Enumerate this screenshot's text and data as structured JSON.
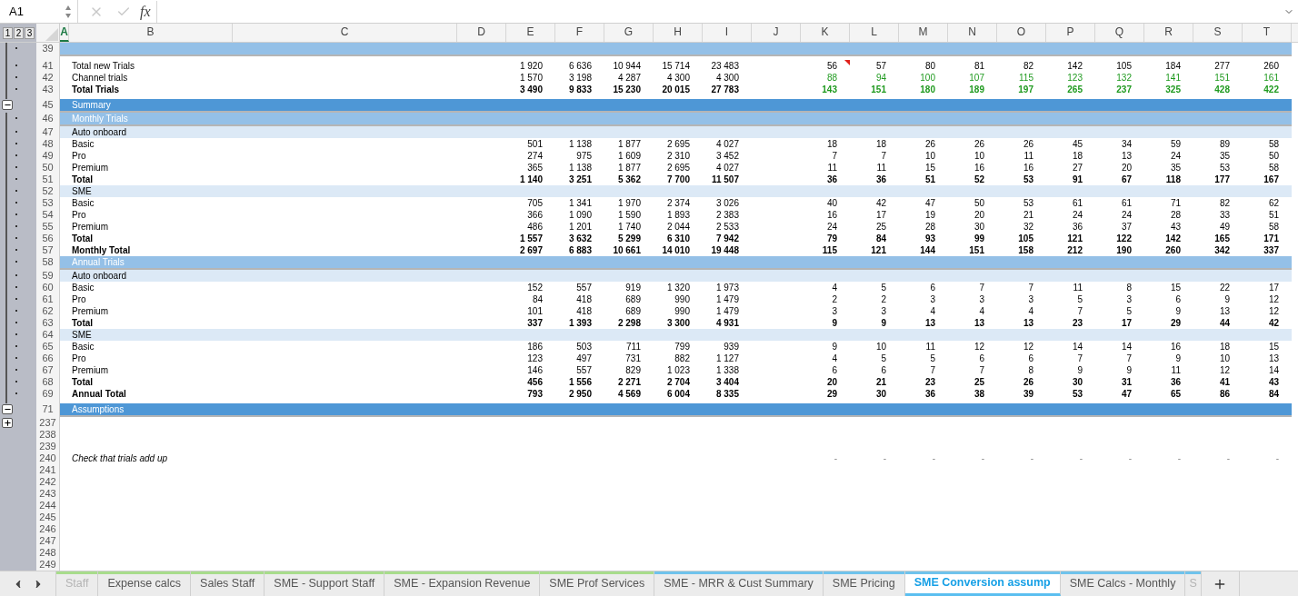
{
  "formula_bar": {
    "name_box": "A1",
    "formula_icon": "fx"
  },
  "outline_levels": [
    {
      "label": "1"
    },
    {
      "label": "2"
    },
    {
      "label": "3"
    }
  ],
  "columns": [
    {
      "label": "A",
      "selected": true
    },
    {
      "label": "B",
      "selected": false
    },
    {
      "label": "C",
      "selected": false
    },
    {
      "label": "D",
      "selected": false
    },
    {
      "label": "E",
      "selected": false
    },
    {
      "label": "F",
      "selected": false
    },
    {
      "label": "G",
      "selected": false
    },
    {
      "label": "H",
      "selected": false
    },
    {
      "label": "I",
      "selected": false
    },
    {
      "label": "J",
      "selected": false
    },
    {
      "label": "K",
      "selected": false
    },
    {
      "label": "L",
      "selected": false
    },
    {
      "label": "M",
      "selected": false
    },
    {
      "label": "N",
      "selected": false
    },
    {
      "label": "O",
      "selected": false
    },
    {
      "label": "P",
      "selected": false
    },
    {
      "label": "Q",
      "selected": false
    },
    {
      "label": "R",
      "selected": false
    },
    {
      "label": "S",
      "selected": false
    },
    {
      "label": "T",
      "selected": false
    }
  ],
  "rows": [
    {
      "num": "39",
      "kind": "subsection",
      "outline": {
        "kind": "dot"
      },
      "hidden_after": true
    },
    {
      "num": "41",
      "kind": "item",
      "label": "Total new Trials",
      "ei": [
        "1 920",
        "6 636",
        "10 944",
        "15 714",
        "23 483"
      ],
      "kt": [
        "56",
        "57",
        "80",
        "81",
        "82",
        "142",
        "105",
        "184",
        "277",
        "260"
      ],
      "outline": {
        "kind": "dot"
      },
      "comment": true
    },
    {
      "num": "42",
      "kind": "item",
      "label": "Channel trials",
      "ei": [
        "1 570",
        "3 198",
        "4 287",
        "4 300",
        "4 300"
      ],
      "kt": [
        "88",
        "94",
        "100",
        "107",
        "115",
        "123",
        "132",
        "141",
        "151",
        "161"
      ],
      "outline": {
        "kind": "dot"
      },
      "green": true
    },
    {
      "num": "43",
      "kind": "total",
      "label": "Total Trials",
      "ei": [
        "3 490",
        "9 833",
        "15 230",
        "20 015",
        "27 783"
      ],
      "kt": [
        "143",
        "151",
        "180",
        "189",
        "197",
        "265",
        "237",
        "325",
        "428",
        "422"
      ],
      "outline": {
        "kind": "dot"
      },
      "green": true,
      "hidden_after": true
    },
    {
      "num": "45",
      "kind": "section",
      "label": "Summary",
      "outline": {
        "kind": "minus"
      }
    },
    {
      "num": "46",
      "kind": "subsection",
      "label": "Monthly Trials",
      "outline": {
        "kind": "dot"
      }
    },
    {
      "num": "47",
      "kind": "group",
      "label": "Auto onboard",
      "outline": {
        "kind": "dot"
      }
    },
    {
      "num": "48",
      "kind": "item",
      "label": "Basic",
      "ei": [
        "501",
        "1 138",
        "1 877",
        "2 695",
        "4 027"
      ],
      "kt": [
        "18",
        "18",
        "26",
        "26",
        "26",
        "45",
        "34",
        "59",
        "89",
        "58"
      ],
      "outline": {
        "kind": "dot"
      }
    },
    {
      "num": "49",
      "kind": "item",
      "label": "Pro",
      "ei": [
        "274",
        "975",
        "1 609",
        "2 310",
        "3 452"
      ],
      "kt": [
        "7",
        "7",
        "10",
        "10",
        "11",
        "18",
        "13",
        "24",
        "35",
        "50"
      ],
      "outline": {
        "kind": "dot"
      }
    },
    {
      "num": "50",
      "kind": "item",
      "label": "Premium",
      "ei": [
        "365",
        "1 138",
        "1 877",
        "2 695",
        "4 027"
      ],
      "kt": [
        "11",
        "11",
        "15",
        "16",
        "16",
        "27",
        "20",
        "35",
        "53",
        "58"
      ],
      "outline": {
        "kind": "dot"
      }
    },
    {
      "num": "51",
      "kind": "total",
      "label": "Total",
      "ei": [
        "1 140",
        "3 251",
        "5 362",
        "7 700",
        "11 507"
      ],
      "kt": [
        "36",
        "36",
        "51",
        "52",
        "53",
        "91",
        "67",
        "118",
        "177",
        "167"
      ],
      "outline": {
        "kind": "dot"
      }
    },
    {
      "num": "52",
      "kind": "group",
      "label": "SME",
      "outline": {
        "kind": "dot"
      }
    },
    {
      "num": "53",
      "kind": "item",
      "label": "Basic",
      "ei": [
        "705",
        "1 341",
        "1 970",
        "2 374",
        "3 026"
      ],
      "kt": [
        "40",
        "42",
        "47",
        "50",
        "53",
        "61",
        "61",
        "71",
        "82",
        "62"
      ],
      "outline": {
        "kind": "dot"
      }
    },
    {
      "num": "54",
      "kind": "item",
      "label": "Pro",
      "ei": [
        "366",
        "1 090",
        "1 590",
        "1 893",
        "2 383"
      ],
      "kt": [
        "16",
        "17",
        "19",
        "20",
        "21",
        "24",
        "24",
        "28",
        "33",
        "51"
      ],
      "outline": {
        "kind": "dot"
      }
    },
    {
      "num": "55",
      "kind": "item",
      "label": "Premium",
      "ei": [
        "486",
        "1 201",
        "1 740",
        "2 044",
        "2 533"
      ],
      "kt": [
        "24",
        "25",
        "28",
        "30",
        "32",
        "36",
        "37",
        "43",
        "49",
        "58"
      ],
      "outline": {
        "kind": "dot"
      }
    },
    {
      "num": "56",
      "kind": "total",
      "label": "Total",
      "ei": [
        "1 557",
        "3 632",
        "5 299",
        "6 310",
        "7 942"
      ],
      "kt": [
        "79",
        "84",
        "93",
        "99",
        "105",
        "121",
        "122",
        "142",
        "165",
        "171"
      ],
      "outline": {
        "kind": "dot"
      }
    },
    {
      "num": "57",
      "kind": "total",
      "label": "Monthly Total",
      "ei": [
        "2 697",
        "6 883",
        "10 661",
        "14 010",
        "19 448"
      ],
      "kt": [
        "115",
        "121",
        "144",
        "151",
        "158",
        "212",
        "190",
        "260",
        "342",
        "337"
      ],
      "outline": {
        "kind": "dot"
      }
    },
    {
      "num": "58",
      "kind": "subsection",
      "label": "Annual Trials",
      "outline": {
        "kind": "dot"
      }
    },
    {
      "num": "59",
      "kind": "group",
      "label": "Auto onboard",
      "outline": {
        "kind": "dot"
      }
    },
    {
      "num": "60",
      "kind": "item",
      "label": "Basic",
      "ei": [
        "152",
        "557",
        "919",
        "1 320",
        "1 973"
      ],
      "kt": [
        "4",
        "5",
        "6",
        "7",
        "7",
        "11",
        "8",
        "15",
        "22",
        "17"
      ],
      "outline": {
        "kind": "dot"
      }
    },
    {
      "num": "61",
      "kind": "item",
      "label": "Pro",
      "ei": [
        "84",
        "418",
        "689",
        "990",
        "1 479"
      ],
      "kt": [
        "2",
        "2",
        "3",
        "3",
        "3",
        "5",
        "3",
        "6",
        "9",
        "12"
      ],
      "outline": {
        "kind": "dot"
      }
    },
    {
      "num": "62",
      "kind": "item",
      "label": "Premium",
      "ei": [
        "101",
        "418",
        "689",
        "990",
        "1 479"
      ],
      "kt": [
        "3",
        "3",
        "4",
        "4",
        "4",
        "7",
        "5",
        "9",
        "13",
        "12"
      ],
      "outline": {
        "kind": "dot"
      }
    },
    {
      "num": "63",
      "kind": "total",
      "label": "Total",
      "ei": [
        "337",
        "1 393",
        "2 298",
        "3 300",
        "4 931"
      ],
      "kt": [
        "9",
        "9",
        "13",
        "13",
        "13",
        "23",
        "17",
        "29",
        "44",
        "42"
      ],
      "outline": {
        "kind": "dot"
      }
    },
    {
      "num": "64",
      "kind": "group",
      "label": "SME",
      "outline": {
        "kind": "dot"
      }
    },
    {
      "num": "65",
      "kind": "item",
      "label": "Basic",
      "ei": [
        "186",
        "503",
        "711",
        "799",
        "939"
      ],
      "kt": [
        "9",
        "10",
        "11",
        "12",
        "12",
        "14",
        "14",
        "16",
        "18",
        "15"
      ],
      "outline": {
        "kind": "dot"
      }
    },
    {
      "num": "66",
      "kind": "item",
      "label": "Pro",
      "ei": [
        "123",
        "497",
        "731",
        "882",
        "1 127"
      ],
      "kt": [
        "4",
        "5",
        "5",
        "6",
        "6",
        "7",
        "7",
        "9",
        "10",
        "13"
      ],
      "outline": {
        "kind": "dot"
      }
    },
    {
      "num": "67",
      "kind": "item",
      "label": "Premium",
      "ei": [
        "146",
        "557",
        "829",
        "1 023",
        "1 338"
      ],
      "kt": [
        "6",
        "6",
        "7",
        "7",
        "8",
        "9",
        "9",
        "11",
        "12",
        "14"
      ],
      "outline": {
        "kind": "dot"
      }
    },
    {
      "num": "68",
      "kind": "total",
      "label": "Total",
      "ei": [
        "456",
        "1 556",
        "2 271",
        "2 704",
        "3 404"
      ],
      "kt": [
        "20",
        "21",
        "23",
        "25",
        "26",
        "30",
        "31",
        "36",
        "41",
        "43"
      ],
      "outline": {
        "kind": "dot"
      }
    },
    {
      "num": "69",
      "kind": "total",
      "label": "Annual Total",
      "ei": [
        "793",
        "2 950",
        "4 569",
        "6 004",
        "8 335"
      ],
      "kt": [
        "29",
        "30",
        "36",
        "38",
        "39",
        "53",
        "47",
        "65",
        "86",
        "84"
      ],
      "outline": {
        "kind": "dot"
      },
      "hidden_after": true
    },
    {
      "num": "71",
      "kind": "section",
      "label": "Assumptions",
      "outline": {
        "kind": "minus"
      }
    },
    {
      "num": "237",
      "kind": "blank",
      "outline": {
        "kind": "plus"
      }
    },
    {
      "num": "238",
      "kind": "blank"
    },
    {
      "num": "239",
      "kind": "blank"
    },
    {
      "num": "240",
      "kind": "check",
      "label": "Check that trials add up",
      "kt": [
        "-",
        "-",
        "-",
        "-",
        "-",
        "-",
        "-",
        "-",
        "-",
        "-"
      ]
    },
    {
      "num": "241",
      "kind": "blank"
    },
    {
      "num": "242",
      "kind": "blank"
    },
    {
      "num": "243",
      "kind": "blank"
    },
    {
      "num": "244",
      "kind": "blank"
    },
    {
      "num": "245",
      "kind": "blank"
    },
    {
      "num": "246",
      "kind": "blank"
    },
    {
      "num": "247",
      "kind": "blank"
    },
    {
      "num": "248",
      "kind": "blank"
    },
    {
      "num": "249",
      "kind": "blank"
    }
  ],
  "sheet_tabs": [
    {
      "label": "Staff",
      "selected": false,
      "dimmed": true,
      "color": "#a8dc8c"
    },
    {
      "label": "Expense calcs",
      "selected": false,
      "dimmed": false,
      "color": "#a8dc8c"
    },
    {
      "label": "Sales Staff",
      "selected": false,
      "dimmed": false,
      "color": "#a8dc8c"
    },
    {
      "label": "SME - Support Staff",
      "selected": false,
      "dimmed": false,
      "color": "#a8dc8c"
    },
    {
      "label": "SME - Expansion Revenue",
      "selected": false,
      "dimmed": false,
      "color": "#a8dc8c"
    },
    {
      "label": "SME Prof Services",
      "selected": false,
      "dimmed": false,
      "color": "#a8dc8c"
    },
    {
      "label": "SME - MRR & Cust Summary",
      "selected": false,
      "dimmed": false,
      "color": "#6fc3ec"
    },
    {
      "label": "SME Pricing",
      "selected": false,
      "dimmed": false,
      "color": "#6fc3ec"
    },
    {
      "label": "SME Conversion assump",
      "selected": true,
      "dimmed": false,
      "color": "#6fc3ec"
    },
    {
      "label": "SME Calcs - Monthly",
      "selected": false,
      "dimmed": false,
      "color": "#6fc3ec"
    },
    {
      "label": "S",
      "selected": false,
      "dimmed": true,
      "color": "#6fc3ec"
    }
  ]
}
